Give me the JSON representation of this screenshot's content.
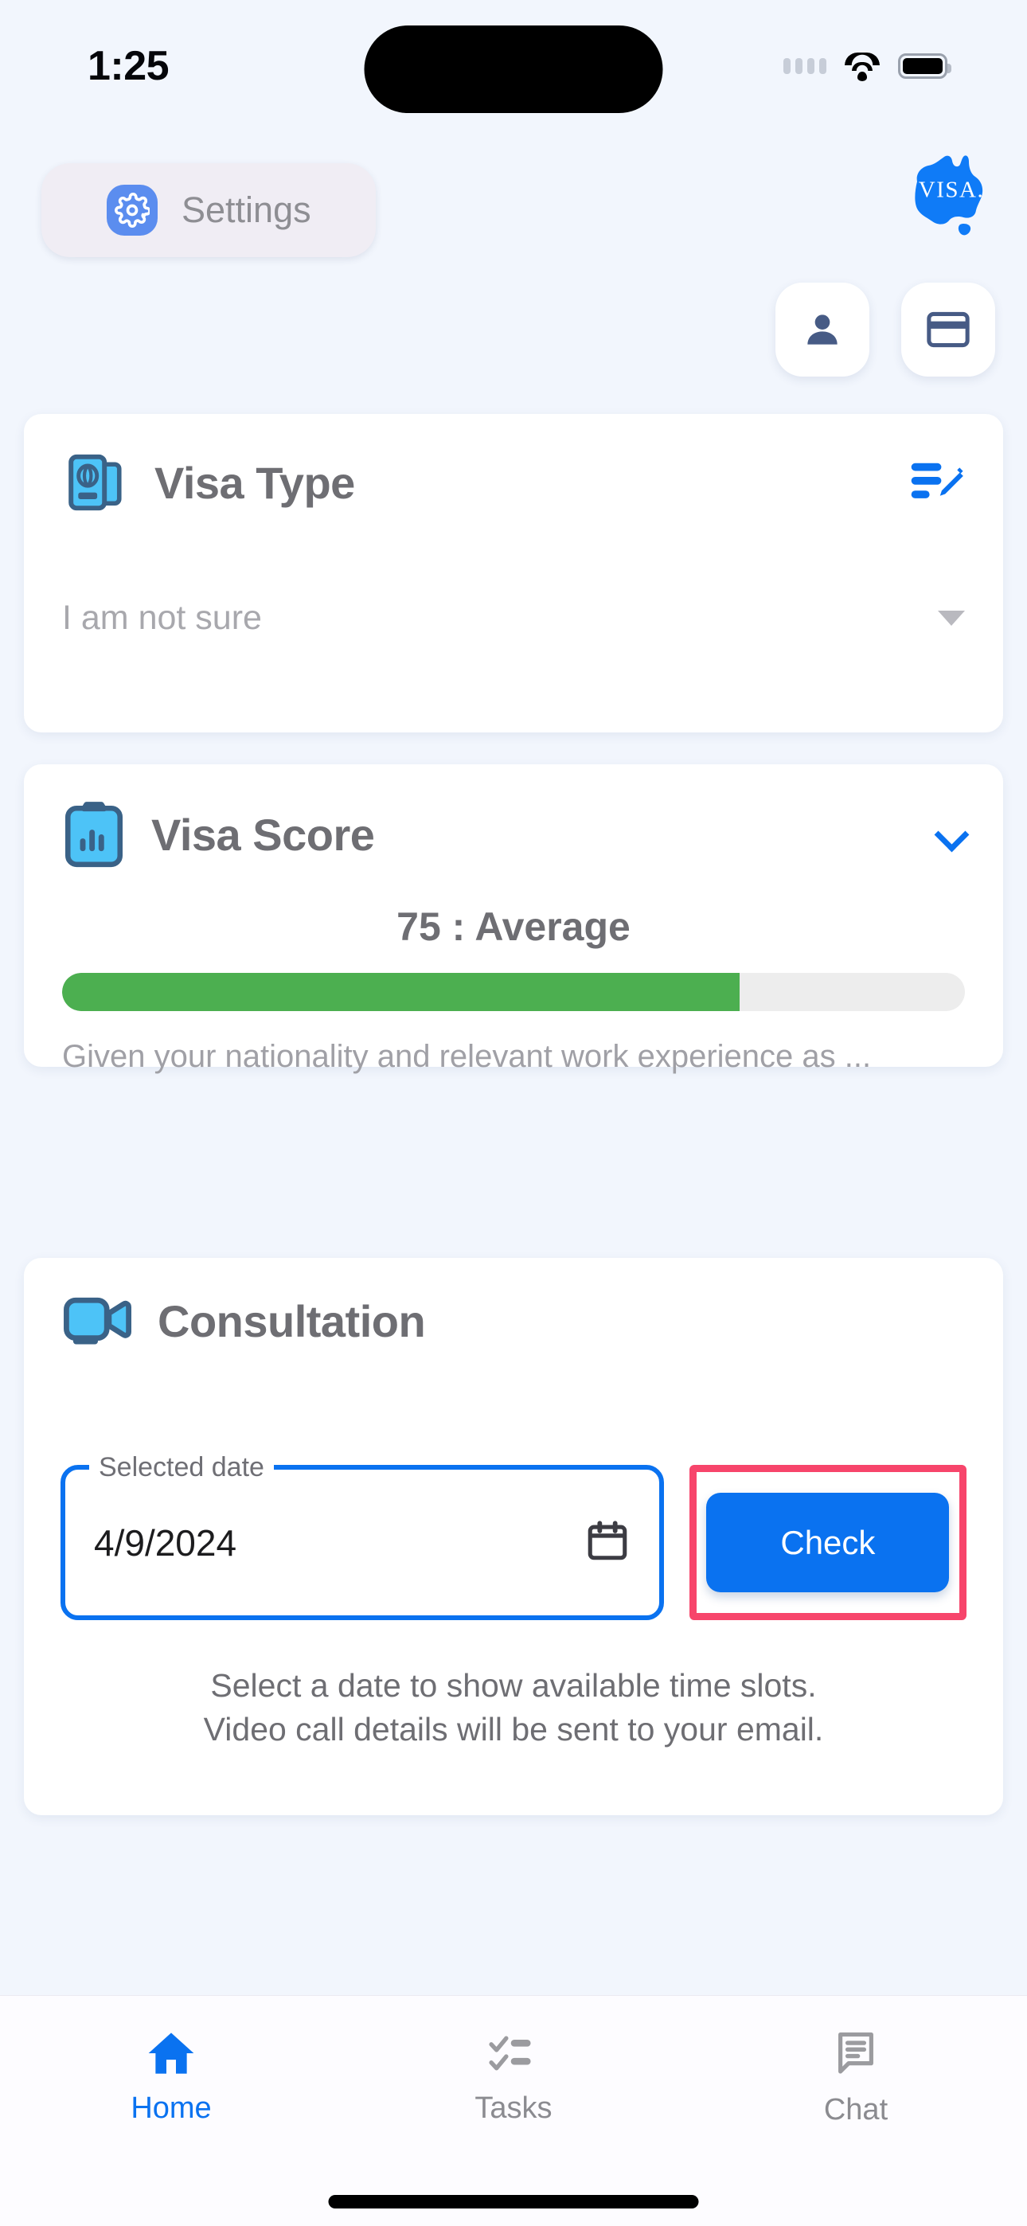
{
  "status_bar": {
    "time": "1:25",
    "icons": [
      "cellular-dots-icon",
      "wifi-icon",
      "battery-icon"
    ]
  },
  "header": {
    "settings_label": "Settings",
    "settings_icon": "gear-icon",
    "logo_text": "VISA.",
    "logo_icon": "australia-map-icon",
    "profile_icon": "person-icon",
    "card_icon": "credit-card-icon"
  },
  "visa_type_card": {
    "title": "Visa Type",
    "icon": "passport-icon",
    "edit_icon": "edit-list-icon",
    "selected_value": "I am not sure",
    "dropdown_icon": "caret-down-icon"
  },
  "visa_score_card": {
    "title": "Visa Score",
    "icon": "clipboard-chart-icon",
    "expand_icon": "chevron-down-icon",
    "score_text": "75 : Average",
    "score_value": 75,
    "progress_percent": 75,
    "progress_color": "#4caf50",
    "description": "Given your nationality and relevant work experience as ..."
  },
  "consultation_card": {
    "title": "Consultation",
    "icon": "video-camera-icon",
    "date_label": "Selected date",
    "date_value": "4/9/2024",
    "calendar_icon": "calendar-icon",
    "check_button_label": "Check",
    "highlight_color": "#f7456b",
    "note_line1": "Select a date to show available time slots.",
    "note_line2": "Video call details will be sent to your email."
  },
  "bottom_nav": {
    "items": [
      {
        "label": "Home",
        "icon": "home-icon",
        "active": true
      },
      {
        "label": "Tasks",
        "icon": "checklist-icon",
        "active": false
      },
      {
        "label": "Chat",
        "icon": "chat-bubble-icon",
        "active": false
      }
    ]
  },
  "colors": {
    "background": "#f2f6fd",
    "accent_blue": "#0a72f0",
    "icon_light_blue": "#4dc3f7",
    "icon_dark_blue": "#3a6287",
    "muted_text": "#6e6e73"
  }
}
